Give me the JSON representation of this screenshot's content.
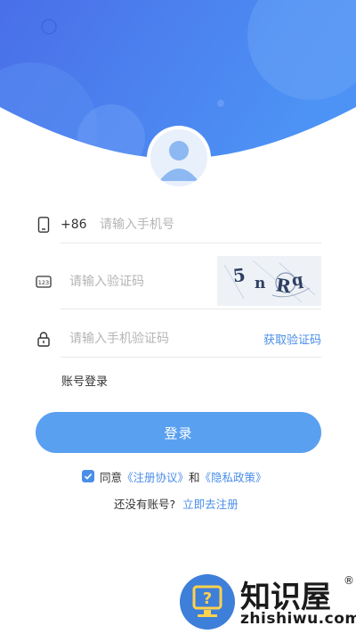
{
  "colors": {
    "header_gradient_start": "#4a6fe8",
    "header_gradient_end": "#4d93f5",
    "accent": "#4a8ee8",
    "button": "#5aa0f0"
  },
  "header": {
    "avatar_icon": "user-avatar-icon"
  },
  "phone": {
    "icon": "phone-icon",
    "prefix": "+86",
    "placeholder": "请输入手机号"
  },
  "captcha": {
    "icon": "number-123-icon",
    "placeholder": "请输入验证码",
    "image_text": "5nRq"
  },
  "sms": {
    "icon": "lock-icon",
    "placeholder": "请输入手机验证码",
    "get_code_label": "获取验证码"
  },
  "account_login_label": "账号登录",
  "login_button_label": "登录",
  "agreement": {
    "checked": true,
    "prefix": "同意",
    "terms_link": "《注册协议》",
    "and": "和",
    "privacy_link": "《隐私政策》"
  },
  "register": {
    "question": "还没有账号?",
    "link": "立即去注册"
  },
  "watermark": {
    "brand": "知识屋",
    "registered": "®",
    "url": "zhishiwu.com"
  }
}
